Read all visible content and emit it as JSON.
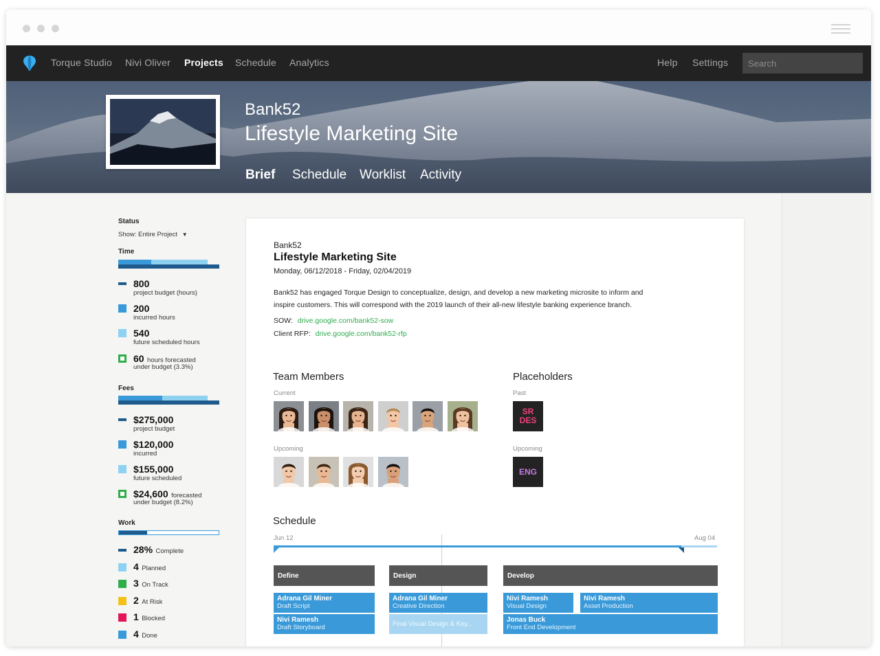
{
  "nav": {
    "items": [
      "Torque Studio",
      "Nivi Oliver",
      "Projects",
      "Schedule",
      "Analytics"
    ],
    "active": "Projects",
    "right": [
      "Help",
      "Settings"
    ],
    "search_placeholder": "Search"
  },
  "hero": {
    "client": "Bank52",
    "title": "Lifestyle Marketing Site",
    "tabs": [
      "Brief",
      "Schedule",
      "Worklist",
      "Activity"
    ]
  },
  "sidebar": {
    "status_heading": "Status",
    "show_label": "Show: Entire Project",
    "time": {
      "heading": "Time",
      "items": [
        {
          "value": "800",
          "label": "project budget (hours)"
        },
        {
          "value": "200",
          "label": "incurred hours"
        },
        {
          "value": "540",
          "label": "future scheduled hours"
        },
        {
          "value": "60",
          "suffix": "hours forecasted",
          "label": "under budget (3.3%)"
        }
      ]
    },
    "fees": {
      "heading": "Fees",
      "items": [
        {
          "value": "$275,000",
          "label": "project budget"
        },
        {
          "value": "$120,000",
          "label": "incurred"
        },
        {
          "value": "$155,000",
          "label": "future scheduled"
        },
        {
          "value": "$24,600",
          "suffix": "forecasted",
          "label": "under budget (8.2%)"
        }
      ]
    },
    "work": {
      "heading": "Work",
      "complete_fraction": 0.28,
      "items": [
        {
          "value": "28%",
          "label": "Complete",
          "color": "#1f5a8c"
        },
        {
          "value": "4",
          "label": "Planned",
          "color": "#8fd1f1"
        },
        {
          "value": "3",
          "label": "On Track",
          "color": "#2fad4a"
        },
        {
          "value": "2",
          "label": "At Risk",
          "color": "#f2c21b"
        },
        {
          "value": "1",
          "label": "Blocked",
          "color": "#e3165b"
        },
        {
          "value": "4",
          "label": "Done",
          "color": "#3a9ad9"
        }
      ]
    }
  },
  "brief": {
    "client": "Bank52",
    "title": "Lifestyle Marketing Site",
    "dates": "Monday, 06/12/2018 - Friday, 02/04/2019",
    "description_line1": "Bank52 has engaged Torque Design to conceptualize, design, and develop a new marketing microsite to inform and",
    "description_line2": "inspire customers. This will correspond with the 2019 launch of their all-new lifestyle banking experience branch.",
    "sow_label": "SOW:",
    "sow_link": "drive.google.com/bank52-sow",
    "rfp_label": "Client RFP:",
    "rfp_link": "drive.google.com/bank52-rfp"
  },
  "team": {
    "heading": "Team Members",
    "current_label": "Current",
    "upcoming_label": "Upcoming"
  },
  "placeholders": {
    "heading": "Placeholders",
    "past_label": "Past",
    "past_item": [
      "SR",
      "DES"
    ],
    "upcoming_label": "Upcoming",
    "upcoming_item": "ENG"
  },
  "schedule": {
    "heading": "Schedule",
    "start": "Jun 12",
    "end": "Aug 04",
    "phases": [
      "Define",
      "Design",
      "Develop"
    ],
    "tasks": [
      {
        "name": "Adrana Gil Miner",
        "role": "Draft Script"
      },
      {
        "name": "Nivi Ramesh",
        "role": "Draft Storyboard"
      },
      {
        "name": "Adrana Gil Miner",
        "role": "Creative Direction"
      },
      {
        "name": "",
        "role": "Final Visual Design & Key..."
      },
      {
        "name": "Nivi Ramesh",
        "role": "Visual Design"
      },
      {
        "name": "Nivi Ramesh",
        "role": "Asset Production"
      },
      {
        "name": "Jonas Buck",
        "role": "Front End Development"
      }
    ]
  },
  "colors": {
    "nav_bg": "#222222",
    "accent_blue": "#3a9ad9",
    "dark_blue": "#1f5a8c",
    "light_blue": "#8fd1f1",
    "green": "#2fad4a",
    "link_green": "#2eab4f"
  }
}
